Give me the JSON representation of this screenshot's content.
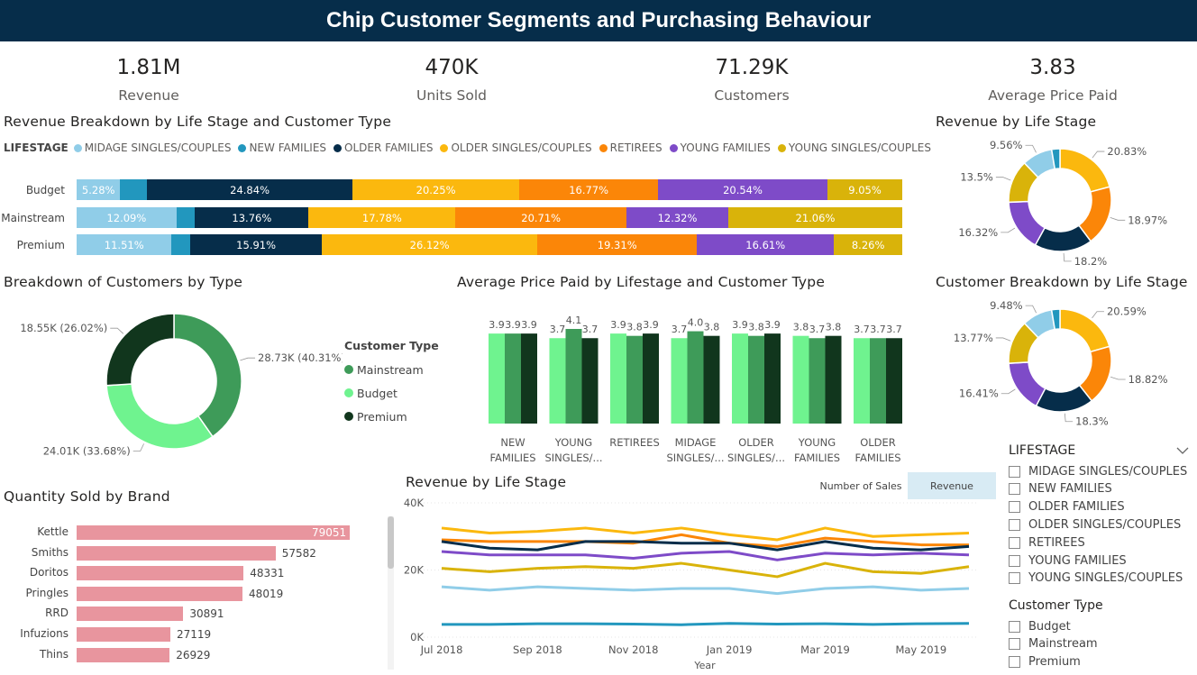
{
  "header": {
    "title": "Chip Customer Segments and Purchasing Behaviour"
  },
  "kpis": [
    {
      "value": "1.81M",
      "label": "Revenue"
    },
    {
      "value": "470K",
      "label": "Units Sold"
    },
    {
      "value": "71.29K",
      "label": "Customers"
    },
    {
      "value": "3.83",
      "label": "Average Price Paid"
    }
  ],
  "colors": {
    "midage": "#90cde8",
    "new_families": "#2297be",
    "older_families": "#062d4a",
    "older_singles": "#fbb80e",
    "retirees": "#fb8608",
    "young_families": "#7e4bc8",
    "young_singles": "#d9b30a",
    "mainstream": "#3e9b59",
    "budget": "#6ff38f",
    "premium": "#11361d",
    "brand_bar": "#e8959e"
  },
  "revenue_breakdown": {
    "title": "Revenue Breakdown by Life Stage and Customer Type",
    "legend_title": "LIFESTAGE",
    "legend": [
      "MIDAGE SINGLES/COUPLES",
      "NEW FAMILIES",
      "OLDER FAMILIES",
      "OLDER SINGLES/COUPLES",
      "RETIREES",
      "YOUNG FAMILIES",
      "YOUNG SINGLES/COUPLES"
    ],
    "chart_data": {
      "type": "bar",
      "stacked": "100%",
      "categories": [
        "Budget",
        "Mainstream",
        "Premium"
      ],
      "series": [
        {
          "name": "MIDAGE SINGLES/COUPLES",
          "values": [
            5.28,
            12.09,
            11.51
          ],
          "labels": [
            "5.28%",
            "12.09%",
            "11.51%"
          ]
        },
        {
          "name": "NEW FAMILIES",
          "values": [
            3.27,
            2.24,
            2.27
          ],
          "labels": [
            "",
            "",
            ""
          ]
        },
        {
          "name": "OLDER FAMILIES",
          "values": [
            24.84,
            13.76,
            15.91
          ],
          "labels": [
            "24.84%",
            "13.76%",
            "15.91%"
          ]
        },
        {
          "name": "OLDER SINGLES/COUPLES",
          "values": [
            20.25,
            17.78,
            26.12
          ],
          "labels": [
            "20.25%",
            "17.78%",
            "26.12%"
          ]
        },
        {
          "name": "RETIREES",
          "values": [
            16.77,
            20.71,
            19.31
          ],
          "labels": [
            "16.77%",
            "20.71%",
            "19.31%"
          ]
        },
        {
          "name": "YOUNG FAMILIES",
          "values": [
            20.54,
            12.32,
            16.61
          ],
          "labels": [
            "20.54%",
            "12.32%",
            "16.61%"
          ]
        },
        {
          "name": "YOUNG SINGLES/COUPLES",
          "values": [
            9.05,
            21.06,
            8.26
          ],
          "labels": [
            "9.05%",
            "21.06%",
            "8.26%"
          ]
        }
      ]
    }
  },
  "revenue_by_life_stage_donut": {
    "title": "Revenue by Life Stage",
    "chart_data": {
      "type": "pie",
      "donut": true,
      "categories": [
        "OLDER SINGLES/COUPLES",
        "RETIREES",
        "OLDER FAMILIES",
        "YOUNG FAMILIES",
        "YOUNG SINGLES/COUPLES",
        "MIDAGE SINGLES/COUPLES",
        "NEW FAMILIES"
      ],
      "values": [
        20.83,
        18.97,
        18.2,
        16.32,
        13.5,
        9.56,
        2.62
      ],
      "labels": [
        "20.83%",
        "18.97%",
        "18.2%",
        "16.32%",
        "13.5%",
        "9.56%",
        ""
      ]
    }
  },
  "customer_breakdown_donut": {
    "title": "Customer Breakdown by Life Stage",
    "chart_data": {
      "type": "pie",
      "donut": true,
      "categories": [
        "OLDER SINGLES/COUPLES",
        "RETIREES",
        "OLDER FAMILIES",
        "YOUNG FAMILIES",
        "YOUNG SINGLES/COUPLES",
        "MIDAGE SINGLES/COUPLES",
        "NEW FAMILIES"
      ],
      "values": [
        20.59,
        18.82,
        18.3,
        16.41,
        13.77,
        9.48,
        2.63
      ],
      "labels": [
        "20.59%",
        "18.82%",
        "18.3%",
        "16.41%",
        "13.77%",
        "9.48%",
        ""
      ]
    }
  },
  "customers_by_type": {
    "title": "Breakdown of Customers by Type",
    "legend_title": "Customer Type",
    "legend": [
      "Mainstream",
      "Budget",
      "Premium"
    ],
    "chart_data": {
      "type": "pie",
      "donut": true,
      "categories": [
        "Mainstream",
        "Budget",
        "Premium"
      ],
      "values": [
        28730,
        24010,
        18550
      ],
      "labels": [
        "28.73K (40.31%)",
        "24.01K (33.68%)",
        "18.55K (26.02%)"
      ]
    }
  },
  "avg_price": {
    "title": "Average Price Paid by Lifestage and Customer Type",
    "category_labels": [
      [
        "NEW",
        "FAMILIES"
      ],
      [
        "YOUNG",
        "SINGLES/..."
      ],
      [
        "RETIREES",
        ""
      ],
      [
        "MIDAGE",
        "SINGLES/..."
      ],
      [
        "OLDER",
        "SINGLES/..."
      ],
      [
        "YOUNG",
        "FAMILIES"
      ],
      [
        "OLDER",
        "FAMILIES"
      ]
    ],
    "chart_data": {
      "type": "bar",
      "categories": [
        "NEW FAMILIES",
        "YOUNG SINGLES/...",
        "RETIREES",
        "MIDAGE SINGLES/...",
        "OLDER SINGLES/...",
        "YOUNG FAMILIES",
        "OLDER FAMILIES"
      ],
      "series": [
        {
          "name": "Budget",
          "values": [
            3.9,
            3.7,
            3.9,
            3.7,
            3.9,
            3.8,
            3.7
          ],
          "labels": [
            "3.9",
            "3.7",
            "3.9",
            "3.7",
            "3.9",
            "3.8",
            "3.7"
          ]
        },
        {
          "name": "Mainstream",
          "values": [
            3.9,
            4.1,
            3.8,
            4.0,
            3.8,
            3.7,
            3.7
          ],
          "labels": [
            "3.9",
            "4.1",
            "3.8",
            "4.0",
            "3.8",
            "3.7",
            "3.7"
          ]
        },
        {
          "name": "Premium",
          "values": [
            3.9,
            3.7,
            3.9,
            3.8,
            3.9,
            3.8,
            3.7
          ],
          "labels": [
            "3.9",
            "3.7",
            "3.9",
            "3.8",
            "3.9",
            "3.8",
            "3.7"
          ]
        }
      ]
    }
  },
  "quantity_by_brand": {
    "title": "Quantity Sold by Brand",
    "chart_data": {
      "type": "bar",
      "orientation": "horizontal",
      "categories": [
        "Kettle",
        "Smiths",
        "Doritos",
        "Pringles",
        "RRD",
        "Infuzions",
        "Thins"
      ],
      "values": [
        79051,
        57582,
        48331,
        48019,
        30891,
        27119,
        26929
      ],
      "labels": [
        "79051",
        "57582",
        "48331",
        "48019",
        "30891",
        "27119",
        "26929"
      ]
    }
  },
  "revenue_trend": {
    "title": "Revenue by Life Stage",
    "toggle": {
      "option_a": "Number of Sales",
      "option_b": "Revenue",
      "selected": "Revenue"
    },
    "chart_data": {
      "type": "line",
      "x": [
        "Jul 2018",
        "Aug 2018",
        "Sep 2018",
        "Oct 2018",
        "Nov 2018",
        "Dec 2018",
        "Jan 2019",
        "Feb 2019",
        "Mar 2019",
        "Apr 2019",
        "May 2019",
        "Jun 2019"
      ],
      "x_tick_labels": [
        "Jul 2018",
        "Sep 2018",
        "Nov 2018",
        "Jan 2019",
        "Mar 2019",
        "May 2019"
      ],
      "xlabel": "Year",
      "ylabel": "",
      "y_tick_labels": [
        "0K",
        "20K",
        "40K"
      ],
      "ylim": [
        0,
        40000
      ],
      "series": [
        {
          "name": "OLDER SINGLES/COUPLES",
          "values": [
            32500,
            31000,
            31500,
            32500,
            31000,
            32500,
            30500,
            29000,
            32500,
            30000,
            30500,
            31000
          ]
        },
        {
          "name": "RETIREES",
          "values": [
            29000,
            28500,
            28500,
            28500,
            28000,
            30500,
            28000,
            27000,
            29500,
            28500,
            27500,
            27500
          ]
        },
        {
          "name": "OLDER FAMILIES",
          "values": [
            28500,
            26500,
            26000,
            28500,
            28500,
            28000,
            28000,
            26000,
            28500,
            26500,
            26000,
            27000
          ]
        },
        {
          "name": "YOUNG FAMILIES",
          "values": [
            25500,
            24500,
            24500,
            24500,
            23500,
            25000,
            25500,
            23000,
            25000,
            24500,
            25000,
            24500
          ]
        },
        {
          "name": "YOUNG SINGLES/COUPLES",
          "values": [
            20500,
            19500,
            20500,
            21000,
            20500,
            22000,
            20000,
            18000,
            22000,
            19500,
            19000,
            21000
          ]
        },
        {
          "name": "MIDAGE SINGLES/COUPLES",
          "values": [
            15000,
            14000,
            15000,
            14500,
            14000,
            14500,
            14500,
            13000,
            14500,
            15000,
            14000,
            14500
          ]
        },
        {
          "name": "NEW FAMILIES",
          "values": [
            3800,
            3800,
            4000,
            4000,
            3900,
            3700,
            4100,
            3900,
            4000,
            3800,
            4000,
            4100
          ]
        }
      ]
    }
  },
  "slicers": {
    "lifestage": {
      "title": "LIFESTAGE",
      "items": [
        "MIDAGE SINGLES/COUPLES",
        "NEW FAMILIES",
        "OLDER FAMILIES",
        "OLDER SINGLES/COUPLES",
        "RETIREES",
        "YOUNG FAMILIES",
        "YOUNG SINGLES/COUPLES"
      ]
    },
    "customer_type": {
      "title": "Customer Type",
      "items": [
        "Budget",
        "Mainstream",
        "Premium"
      ]
    }
  }
}
